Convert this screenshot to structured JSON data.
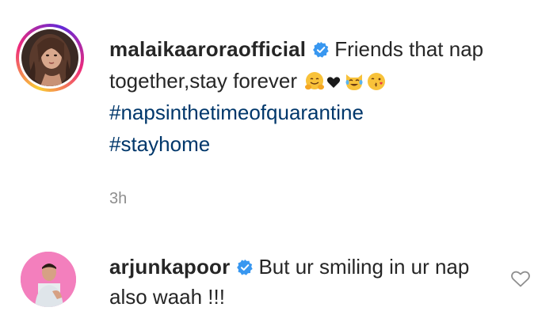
{
  "post": {
    "username": "malaikaaroraofficial",
    "caption_text": "Friends that nap together,stay forever",
    "hashtags": [
      "#napsinthetimeofquarantine",
      "#stayhome"
    ],
    "timestamp": "3h",
    "emojis": [
      "hugging-face",
      "black-heart",
      "cat-tears-of-joy",
      "face-blowing-kiss"
    ]
  },
  "comment": {
    "username": "arjunkapoor",
    "text": "But ur smiling in ur nap also waah !!!"
  },
  "colors": {
    "text": "#262626",
    "hashtag": "#00376b",
    "timestamp": "#8e8e8e",
    "verified": "#3897f0",
    "comment_avatar_bg": "#f37fbd"
  }
}
